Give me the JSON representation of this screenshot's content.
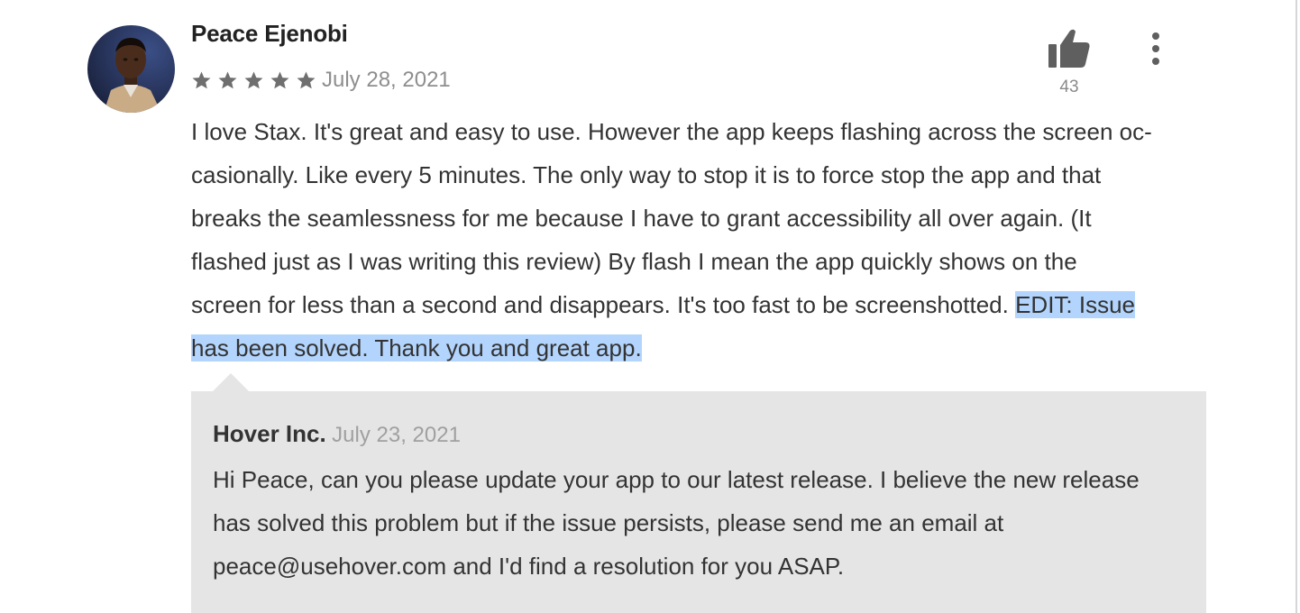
{
  "review": {
    "reviewer_name": "Peace Ejenobi",
    "rating": 5,
    "max_rating": 5,
    "date": "July 28, 2021",
    "helpful_count": "43",
    "lines": [
      "I love Stax. It's great and easy to use. However the app keeps flashing across the screen oc-",
      "casionally. Like every 5 minutes. The only way to stop it is to force stop the app and that",
      "breaks the seamlessness for me because I have to grant accessibility all over again. (It",
      "flashed just as I was writing this review) By flash I mean the app quickly shows on the",
      "screen for less than a second and disappears. It's too fast to be screenshotted.",
      "has been solved. Thank you and great app."
    ],
    "highlighted_edit_start": "EDIT: Issue",
    "line5_spacer": " "
  },
  "developer_reply": {
    "developer_name": "Hover Inc.",
    "date": "July 23, 2021",
    "lines": [
      "Hi Peace, can you please update your app to our latest release. I believe the new release",
      "has solved this problem but if the issue persists, please send me an email at",
      "peace@usehover.com and I'd find a resolution for you ASAP."
    ]
  },
  "icons": {
    "avatar": "avatar-photo",
    "star": "star-icon",
    "thumbs_up": "thumbs-up-icon",
    "more": "more-vert-icon"
  },
  "colors": {
    "star": "#6f6f6f",
    "thumbs_up": "#5f5f5f",
    "selection_highlight": "#b3d5fd",
    "reply_background": "#e5e5e5"
  }
}
